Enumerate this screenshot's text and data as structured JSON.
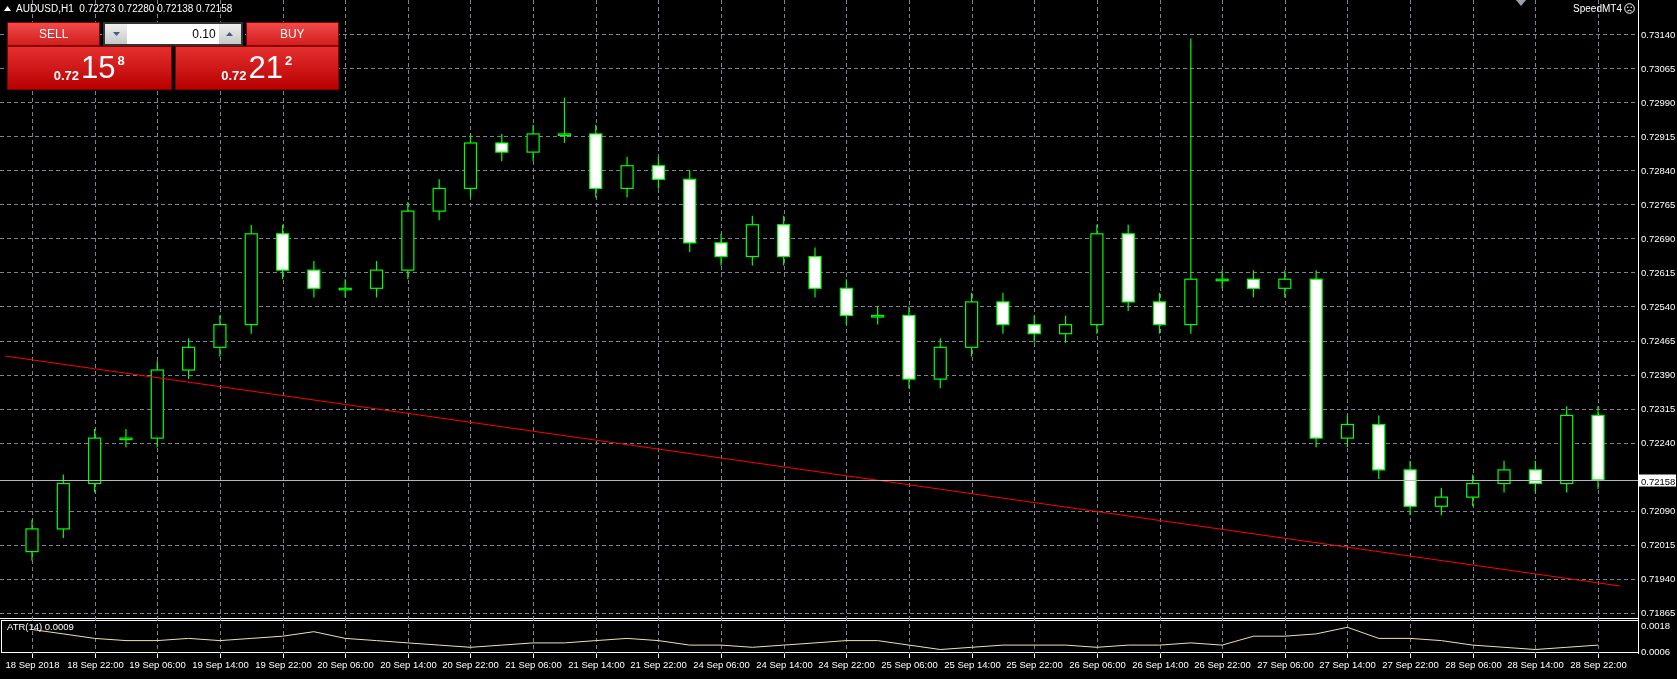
{
  "header": {
    "title": "AUDUSD,H1  0.72273 0.72280 0.72138 0.72158"
  },
  "badge": {
    "label": "SpeedMT4"
  },
  "trade_panel": {
    "sell_label": "SELL",
    "buy_label": "BUY",
    "lot": "0.10",
    "sell_price": {
      "prefix": "0.72",
      "big": "15",
      "small": "8"
    },
    "buy_price": {
      "prefix": "0.72",
      "big": "21",
      "small": "2"
    }
  },
  "chart": {
    "chart_data": {
      "type": "candlestick",
      "ylim": [
        0.71856,
        0.73215
      ],
      "categories": [
        "18 Sep 2018",
        null,
        "18 Sep 22:00",
        null,
        "19 Sep 06:00",
        null,
        "19 Sep 14:00",
        null,
        "19 Sep 22:00",
        null,
        "20 Sep 06:00",
        null,
        "20 Sep 14:00",
        null,
        "20 Sep 22:00",
        null,
        "21 Sep 06:00",
        null,
        "21 Sep 14:00",
        null,
        "21 Sep 22:00",
        null,
        "24 Sep 06:00",
        null,
        "24 Sep 14:00",
        null,
        "24 Sep 22:00",
        null,
        "25 Sep 06:00",
        null,
        "25 Sep 14:00",
        null,
        "25 Sep 22:00",
        null,
        "26 Sep 06:00",
        null,
        "26 Sep 14:00",
        null,
        "26 Sep 22:00",
        null,
        "27 Sep 06:00",
        null,
        "27 Sep 14:00",
        null,
        "27 Sep 22:00",
        null,
        "28 Sep 06:00",
        null,
        "28 Sep 14:00",
        null,
        "28 Sep 22:00"
      ],
      "ohlc": [
        [
          0.72,
          0.7207,
          0.7198,
          0.7205
        ],
        [
          0.7205,
          0.7217,
          0.7203,
          0.7215
        ],
        [
          0.7215,
          0.7227,
          0.7213,
          0.7225
        ],
        [
          0.7225,
          0.7227,
          0.7223,
          0.7225
        ],
        [
          0.7225,
          0.7242,
          0.7223,
          0.724
        ],
        [
          0.724,
          0.7247,
          0.7238,
          0.7245
        ],
        [
          0.7245,
          0.7252,
          0.7243,
          0.725
        ],
        [
          0.725,
          0.7272,
          0.7248,
          0.727
        ],
        [
          0.727,
          0.7272,
          0.726,
          0.7262
        ],
        [
          0.7262,
          0.7264,
          0.7256,
          0.7258
        ],
        [
          0.7258,
          0.726,
          0.7256,
          0.7258
        ],
        [
          0.7258,
          0.7264,
          0.7256,
          0.7262
        ],
        [
          0.7262,
          0.7277,
          0.726,
          0.7275
        ],
        [
          0.7275,
          0.7282,
          0.7273,
          0.728
        ],
        [
          0.728,
          0.7292,
          0.7278,
          0.729
        ],
        [
          0.729,
          0.7292,
          0.7286,
          0.7288
        ],
        [
          0.7288,
          0.7294,
          0.7286,
          0.7292
        ],
        [
          0.7292,
          0.73,
          0.729,
          0.7292
        ],
        [
          0.7292,
          0.7294,
          0.7278,
          0.728
        ],
        [
          0.728,
          0.7287,
          0.7278,
          0.7285
        ],
        [
          0.7285,
          0.7287,
          0.728,
          0.7282
        ],
        [
          0.7282,
          0.7284,
          0.7266,
          0.7268
        ],
        [
          0.7268,
          0.727,
          0.7263,
          0.7265
        ],
        [
          0.7265,
          0.7274,
          0.7263,
          0.7272
        ],
        [
          0.7272,
          0.7274,
          0.7263,
          0.7265
        ],
        [
          0.7265,
          0.7267,
          0.7256,
          0.7258
        ],
        [
          0.7258,
          0.726,
          0.725,
          0.7252
        ],
        [
          0.7252,
          0.7254,
          0.725,
          0.7252
        ],
        [
          0.7252,
          0.7254,
          0.7236,
          0.7238
        ],
        [
          0.7238,
          0.7247,
          0.7236,
          0.7245
        ],
        [
          0.7245,
          0.7257,
          0.7243,
          0.7255
        ],
        [
          0.7255,
          0.7257,
          0.7248,
          0.725
        ],
        [
          0.725,
          0.7252,
          0.7246,
          0.7248
        ],
        [
          0.7248,
          0.7252,
          0.7246,
          0.725
        ],
        [
          0.725,
          0.7272,
          0.7248,
          0.727
        ],
        [
          0.727,
          0.7272,
          0.7253,
          0.7255
        ],
        [
          0.7255,
          0.7257,
          0.7248,
          0.725
        ],
        [
          0.725,
          0.7313,
          0.7248,
          0.726
        ],
        [
          0.726,
          0.7262,
          0.7258,
          0.726
        ],
        [
          0.726,
          0.7262,
          0.7256,
          0.7258
        ],
        [
          0.7258,
          0.7262,
          0.7256,
          0.726
        ],
        [
          0.726,
          0.7262,
          0.7223,
          0.7225
        ],
        [
          0.7225,
          0.723,
          0.7223,
          0.7228
        ],
        [
          0.7228,
          0.723,
          0.7216,
          0.7218
        ],
        [
          0.7218,
          0.722,
          0.7208,
          0.721
        ],
        [
          0.721,
          0.7214,
          0.7208,
          0.7212
        ],
        [
          0.7212,
          0.7217,
          0.721,
          0.7215
        ],
        [
          0.7215,
          0.722,
          0.7213,
          0.7218
        ],
        [
          0.7218,
          0.722,
          0.7213,
          0.7215
        ],
        [
          0.7215,
          0.7232,
          0.7213,
          0.723
        ],
        [
          0.723,
          0.7232,
          0.72138,
          0.72158
        ]
      ],
      "yticks": [
        {
          "value": 0.7314,
          "label": "0.73140"
        },
        {
          "value": 0.73065,
          "label": "0.73065"
        },
        {
          "value": 0.7299,
          "label": "0.72990"
        },
        {
          "value": 0.72915,
          "label": "0.72915"
        },
        {
          "value": 0.7284,
          "label": "0.72840"
        },
        {
          "value": 0.72765,
          "label": "0.72765"
        },
        {
          "value": 0.7269,
          "label": "0.72690"
        },
        {
          "value": 0.72615,
          "label": "0.72615"
        },
        {
          "value": 0.7254,
          "label": "0.72540"
        },
        {
          "value": 0.72465,
          "label": "0.72465"
        },
        {
          "value": 0.7239,
          "label": "0.72390"
        },
        {
          "value": 0.72315,
          "label": "0.72315"
        },
        {
          "value": 0.7224,
          "label": "0.72240"
        },
        {
          "value": 0.7209,
          "label": "0.72090"
        },
        {
          "value": 0.72015,
          "label": "0.72015"
        },
        {
          "value": 0.7194,
          "label": "0.71940"
        },
        {
          "value": 0.71865,
          "label": "0.71865"
        }
      ],
      "grid": true
    },
    "current_price": "0.72158"
  },
  "indicator": {
    "chart_data": {
      "type": "line",
      "grid": true,
      "ylim": [
        0.0005,
        0.00216
      ],
      "series": [
        {
          "name": "ATR(14) 0.0009",
          "color": "#f5deb3",
          "values": [
            0.0016,
            0.0014,
            0.0012,
            0.0011,
            0.0011,
            0.0012,
            0.0011,
            0.0012,
            0.0013,
            0.0015,
            0.0012,
            0.0011,
            0.001,
            0.0009,
            0.0008,
            0.0009,
            0.001,
            0.001,
            0.0011,
            0.0012,
            0.0011,
            0.0009,
            0.0009,
            0.0008,
            0.0009,
            0.001,
            0.0011,
            0.0011,
            0.0009,
            0.0007,
            0.0008,
            0.0009,
            0.0009,
            0.0009,
            0.0008,
            0.0009,
            0.0009,
            0.001,
            0.0009,
            0.0013,
            0.0013,
            0.0014,
            0.0017,
            0.0012,
            0.0012,
            0.0011,
            0.0009,
            0.0008,
            0.0007,
            0.0008,
            0.0009
          ]
        }
      ],
      "yticks": [
        {
          "value": 0.0018,
          "label": "0.0018"
        },
        {
          "value": 0.0006,
          "label": "0.0006"
        }
      ]
    }
  }
}
